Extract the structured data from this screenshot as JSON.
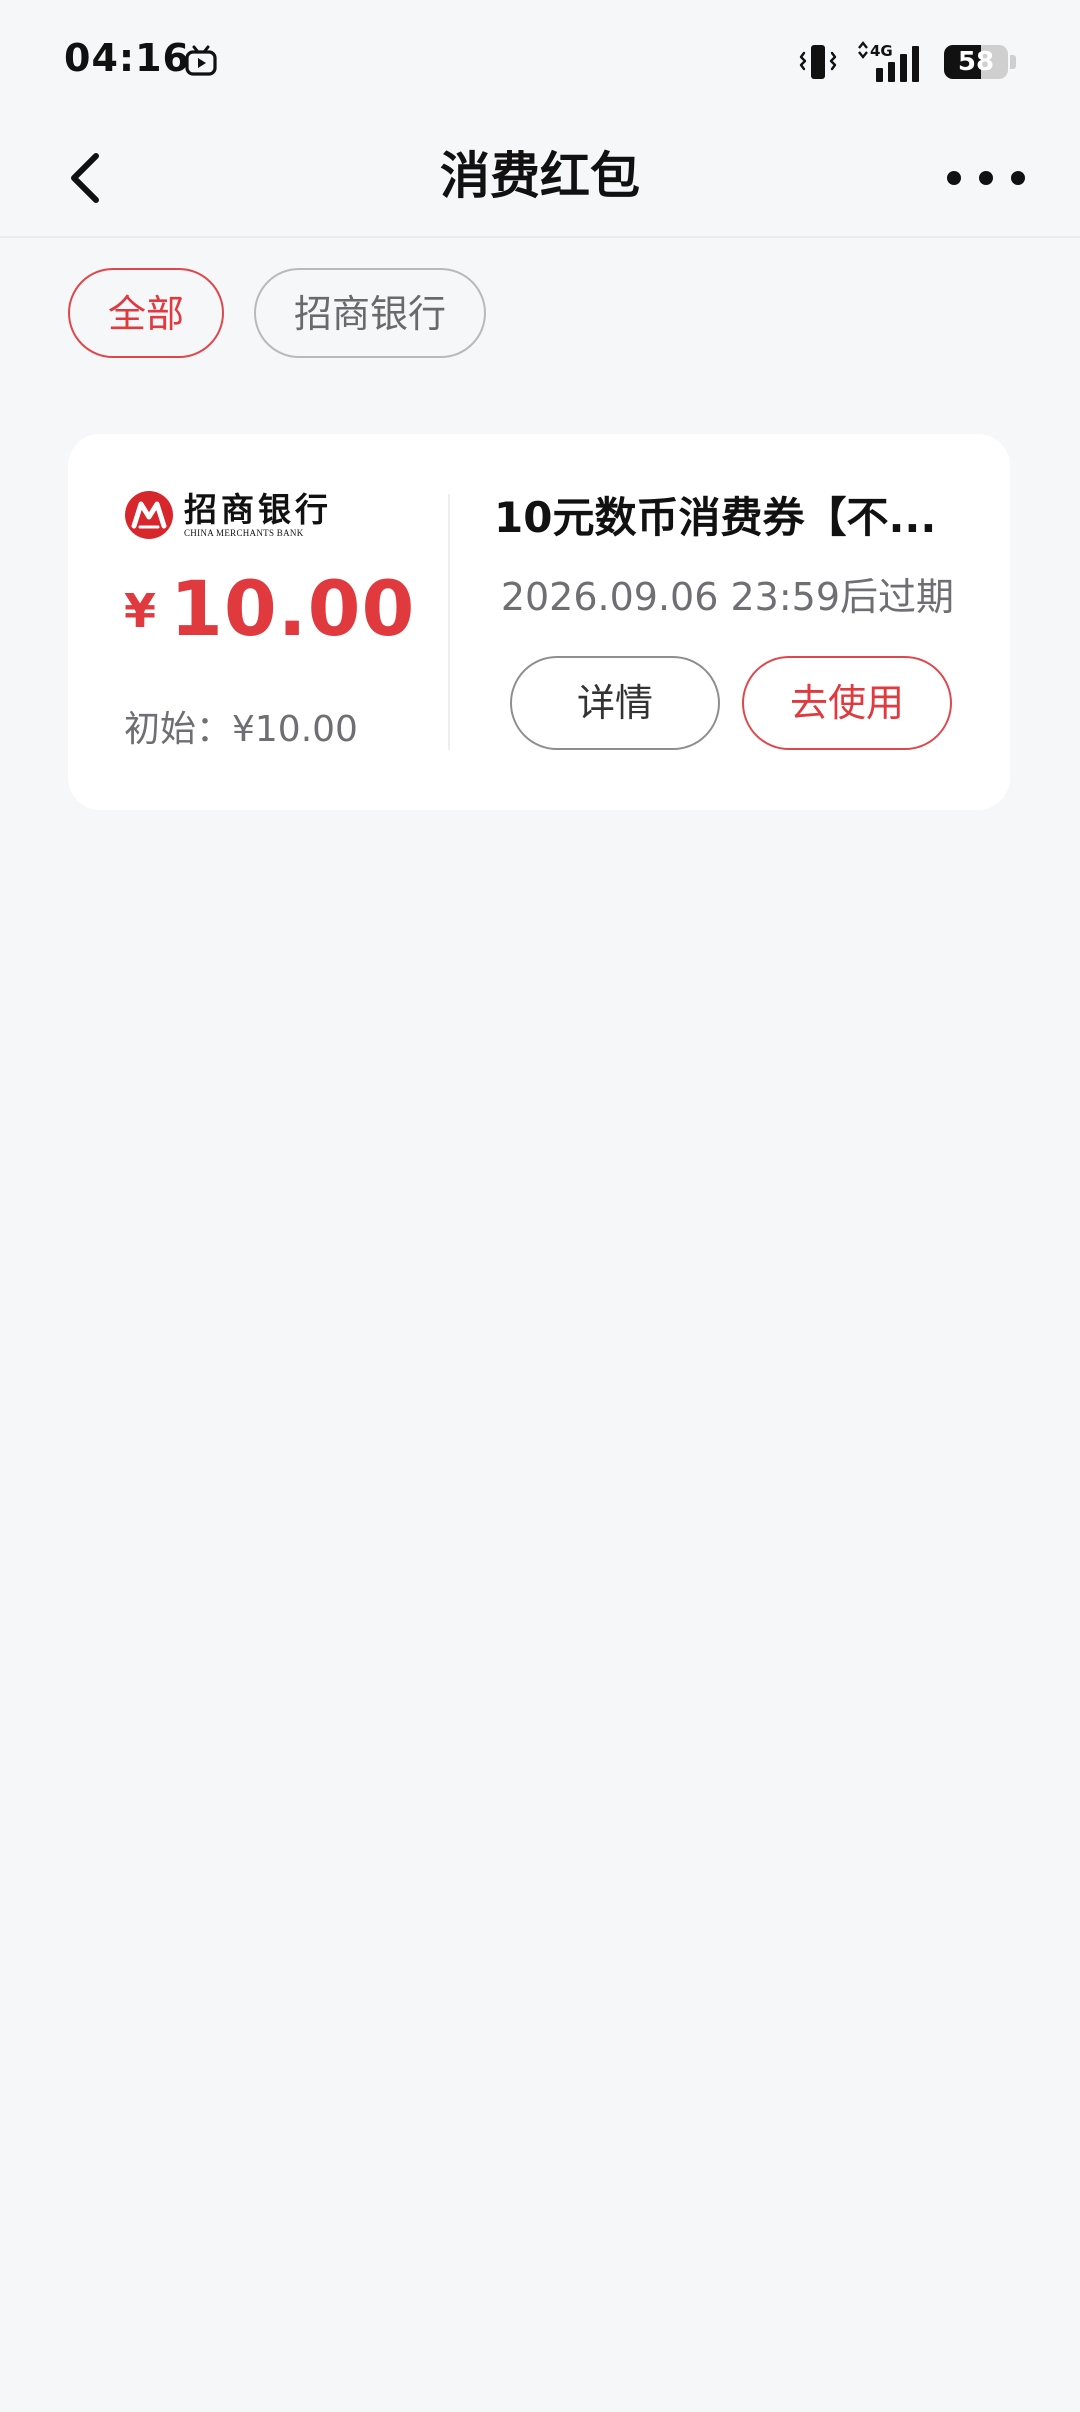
{
  "status_bar": {
    "time": "04:16",
    "network": "4G",
    "battery_percent": 58,
    "battery_text": "58"
  },
  "nav": {
    "title": "消费红包"
  },
  "filters": [
    {
      "label": "全部",
      "active": true
    },
    {
      "label": "招商银行",
      "active": false
    }
  ],
  "coupon": {
    "bank_logo": {
      "name_cn": "招商银行",
      "name_en": "CHINA MERCHANTS BANK"
    },
    "currency_symbol": "¥",
    "amount": "10.00",
    "initial_label": "初始：¥10.00",
    "title": "10元数币消费券【不...",
    "expiry": "2026.09.06 23:59后过期",
    "detail_label": "详情",
    "use_label": "去使用"
  },
  "colors": {
    "accent_red": "#e0393e",
    "background": "#f6f7f9",
    "card": "#ffffff"
  }
}
